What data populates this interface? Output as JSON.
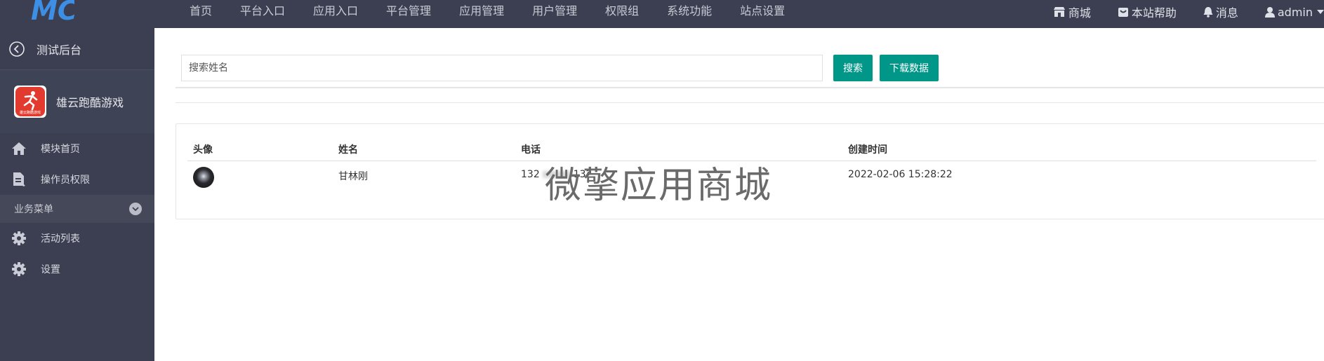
{
  "topnav": {
    "logo_text": "MC",
    "items": [
      "首页",
      "平台入口",
      "应用入口",
      "平台管理",
      "应用管理",
      "用户管理",
      "权限组",
      "系统功能",
      "站点设置"
    ],
    "right": {
      "shop": "商城",
      "help": "本站帮助",
      "messages": "消息",
      "user": "admin"
    }
  },
  "sidebar": {
    "back_title": "测试后台",
    "app_name": "雄云跑酷游戏",
    "app_logo_text": "雄云跑酷游戏",
    "menu": [
      {
        "label": "模块首页",
        "icon": "home-icon"
      },
      {
        "label": "操作员权限",
        "icon": "document-icon"
      }
    ],
    "group_label": "业务菜单",
    "group_items": [
      {
        "label": "活动列表",
        "icon": "gear-icon"
      },
      {
        "label": "设置",
        "icon": "gear-icon"
      }
    ]
  },
  "search": {
    "placeholder": "搜索姓名",
    "search_button": "搜索",
    "download_button": "下载数据"
  },
  "table": {
    "headers": [
      "头像",
      "姓名",
      "电话",
      "创建时间"
    ],
    "rows": [
      {
        "name": "甘林刚",
        "phone_start": "132",
        "phone_end": "132",
        "created": "2022-02-06 15:28:22"
      }
    ]
  },
  "watermark": "微擎应用商城",
  "colors": {
    "topbar": "#3b3f51",
    "sidebar": "#3b3f51",
    "accent": "#009688"
  }
}
